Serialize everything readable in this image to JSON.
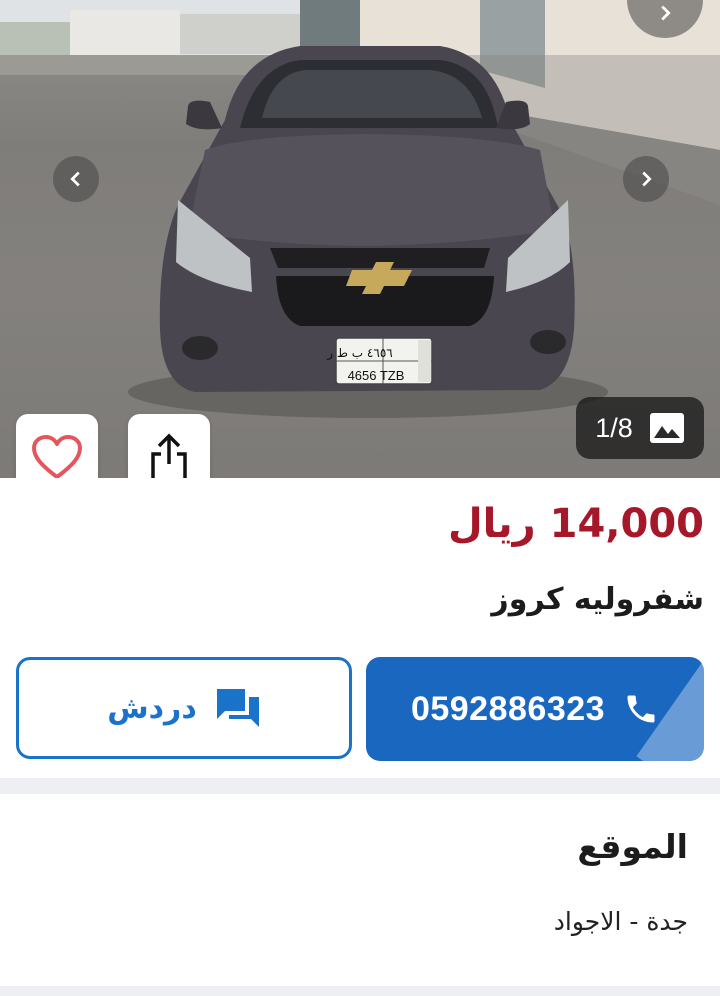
{
  "listing": {
    "image_counter": "1/8",
    "price": "14,000 ريال",
    "title": "شفروليه كروز",
    "plate": {
      "line1": "٤٦٥٦ ب ط ر",
      "line2": "4656 TZB"
    }
  },
  "contact": {
    "chat_label": "دردش",
    "phone": "0592886323"
  },
  "location": {
    "heading": "الموقع",
    "value": "جدة - الاجواد"
  },
  "icons": {
    "prev": "chevron-left-icon",
    "next": "chevron-right-icon",
    "gallery": "image-icon",
    "favorite": "heart-icon",
    "share": "share-icon",
    "chat": "chat-icon",
    "phone": "phone-icon"
  },
  "colors": {
    "price": "#a7172a",
    "primary": "#1a67c0",
    "outline": "#1a73c9",
    "heart": "#e5565c"
  }
}
